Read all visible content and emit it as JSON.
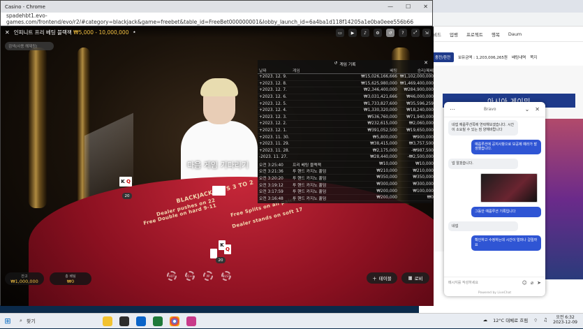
{
  "browser": {
    "title": "Casino - Chrome",
    "url": "spadehbt1.evo-games.com/frontend/evo/r2/#category=blackjack&game=freebet&table_id=FreeBet000000001&lobby_launch_id=6a4ba1d118f14205a1e0ba0eee556b66",
    "controls": [
      "—",
      "☐",
      "✕"
    ]
  },
  "game": {
    "title": "인피니트 프리 베팅 블랙잭",
    "limits": "₩5,000 - 10,000,000",
    "search_placeholder": "검색(사용 해제됨)",
    "waiting_text": "다음 게임 기다리기",
    "table_texts": [
      "BLACKJACK PAYS 3 TO 2",
      "Dealer pushes on 22",
      "Free Double on hard 9-11",
      "Free Splits on all pairs",
      "Dealer stands on soft 17"
    ],
    "dealer_cards": [
      "K",
      "Q"
    ],
    "dealer_score": "20",
    "player_cards": [
      "K",
      "Q"
    ],
    "player_score": "20",
    "balance_label": "잔고",
    "balance_value": "₩1,000,000",
    "bet_label": "총 베팅",
    "bet_value": "₩0",
    "btn_table": "테이블",
    "btn_lobby": "로비",
    "chips": [
      "HOT",
      "21+3",
      "PP",
      "BUST"
    ]
  },
  "history": {
    "title": "게임 기록",
    "headers": [
      "날짜",
      "게임",
      "베팅",
      "승리/패배"
    ],
    "rows": [
      [
        "+2023. 12. 9.",
        "",
        "₩15,026,166,666",
        "₩1,102,000,000"
      ],
      [
        "+2023. 12. 8.",
        "",
        "₩15,625,980,000",
        "₩1,469,400,000"
      ],
      [
        "+2023. 12. 7.",
        "",
        "₩2,346,400,000",
        "₩284,900,000"
      ],
      [
        "+2023. 12. 6.",
        "",
        "₩3,031,421,666",
        "₩46,000,000"
      ],
      [
        "+2023. 12. 5.",
        "",
        "₩1,733,827,600",
        "₩35,596,259"
      ],
      [
        "+2023. 12. 4.",
        "",
        "₩1,330,320,000",
        "₩18,240,000"
      ],
      [
        "+2023. 12. 3.",
        "",
        "₩536,760,000",
        "₩71,940,000"
      ],
      [
        "+2023. 12. 2.",
        "",
        "₩232,615,000",
        "₩2,060,000"
      ],
      [
        "+2023. 12. 1.",
        "",
        "₩391,052,500",
        "₩19,650,000"
      ],
      [
        "+2023. 11. 30.",
        "",
        "₩5,800,000",
        "₩900,000"
      ],
      [
        "+2023. 11. 29.",
        "",
        "₩38,415,000",
        "₩3,757,500"
      ],
      [
        "+2023. 11. 28.",
        "",
        "₩2,175,000",
        "-₩987,500"
      ],
      [
        "-2023. 11. 27.",
        "",
        "₩28,440,000",
        "-₩2,500,000"
      ],
      [
        "오전 3:25:40",
        "프리 베팅 블랙잭",
        "₩10,000",
        "₩10,000"
      ],
      [
        "오전 3:21:36",
        "투 핸드 카지노 홀덤",
        "₩210,000",
        "₩210,000"
      ],
      [
        "오전 3:20:20",
        "투 핸드 카지노 홀덤",
        "₩350,000",
        "₩350,000"
      ],
      [
        "오전 3:19:12",
        "투 핸드 카지노 홀덤",
        "₩300,000",
        "₩300,000"
      ],
      [
        "오전 3:17:59",
        "투 핸드 카지노 홀덤",
        "₩200,000",
        "₩100,000"
      ],
      [
        "오전 3:16:48",
        "투 핸드 카지노 홀덤",
        "₩200,000",
        "₩0"
      ]
    ]
  },
  "background": {
    "bookmarks": [
      "비드",
      "업뱅",
      "프로젝트",
      "행복",
      "Daum"
    ],
    "site_buttons": [
      "충전/환전"
    ],
    "balance_text": "보유금액 : 1,203,006,265원",
    "site_links": [
      "배팅내역",
      "쪽지"
    ],
    "banner": "아시아 게이밍"
  },
  "chat": {
    "brand": "Bravo",
    "messages": [
      {
        "dir": "in",
        "text": "네넵 예룹루션쪽에 연락해보겠습니다. 시간이 소요될 수 있는 점 양해바랍니다"
      },
      {
        "dir": "out",
        "text": "예룹루션에 공지사항으로 보공제 예라가 발생했습니다."
      },
      {
        "dir": "in",
        "text": "넵 알겠습니다."
      },
      {
        "dir": "out",
        "text": "그동안 예룹루션 기록입니다"
      },
      {
        "dir": "in",
        "text": "네넵"
      },
      {
        "dir": "out",
        "text": "확인하고 수정하는데 시간이 얼마나 걸릴까요"
      }
    ],
    "input_placeholder": "메시지를 작성하세요",
    "footer": "Powered by LiveChat"
  },
  "taskbar": {
    "search": "찾기",
    "weather": "12°C 대체로 흐림",
    "time": "오전 6:32",
    "date": "2023-12-09"
  }
}
